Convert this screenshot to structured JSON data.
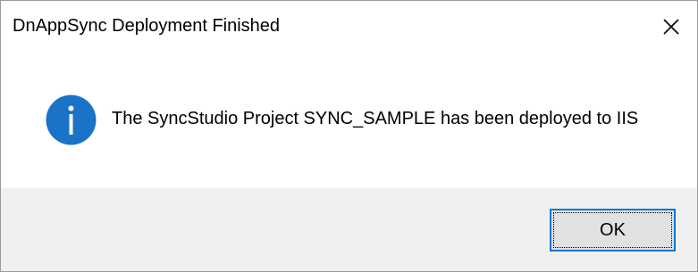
{
  "dialog": {
    "title": "DnAppSync Deployment Finished",
    "icon": "information-icon",
    "message": "The SyncStudio Project SYNC_SAMPLE has been deployed to IIS",
    "ok_label": "OK",
    "close_icon": "close-icon",
    "colors": {
      "icon_blue": "#1a73c8",
      "button_focus_border": "#0078d7",
      "footer_bg": "#f0f0f0",
      "button_bg": "#e1e1e1"
    }
  }
}
